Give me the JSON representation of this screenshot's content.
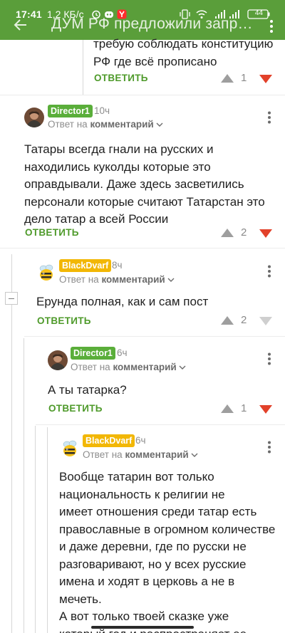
{
  "status_bar": {
    "time": "17:41",
    "network": "1,2 КБ/с",
    "icons": [
      "alarm-icon",
      "discord-icon",
      "yandex-icon"
    ],
    "signal": "4G+",
    "battery": "44"
  },
  "app_bar": {
    "title": "ДУМ РФ предложили запр…"
  },
  "comments": [
    {
      "text_lines": [
        "требую соблюдать конституцию",
        "РФ где всё прописано"
      ],
      "reply_label": "ОТВЕТИТЬ",
      "votes": "1"
    },
    {
      "author": "Director1",
      "time": "10ч",
      "reply_to_prefix": "Ответ на",
      "reply_to_target": "комментарий",
      "text_lines": [
        "Татары всегда гнали на русских и",
        "находились куколды которые это",
        "оправдывали. Даже здесь засветились",
        "персонали которые считают Татарстан это",
        "дело татар а всей России"
      ],
      "reply_label": "ОТВЕТИТЬ",
      "votes": "2"
    },
    {
      "author": "BlackDvarf",
      "time": "8ч",
      "reply_to_prefix": "Ответ на",
      "reply_to_target": "комментарий",
      "text_lines": [
        "Ерунда полная, как и сам пост"
      ],
      "reply_label": "ОТВЕТИТЬ",
      "votes": "2"
    },
    {
      "author": "Director1",
      "time": "6ч",
      "reply_to_prefix": "Ответ на",
      "reply_to_target": "комментарий",
      "text_lines": [
        "А ты татарка?"
      ],
      "reply_label": "ОТВЕТИТЬ",
      "votes": "1"
    },
    {
      "author": "BlackDvarf",
      "time": "6ч",
      "reply_to_prefix": "Ответ на",
      "reply_to_target": "комментарий",
      "text_lines": [
        "Вообще татарин вот только",
        "национальность к религии не",
        "имеет отношения среди татар есть",
        "православные в огромном количестве",
        "и даже деревни, где по русски не",
        "разговаривают, но у всех русские",
        "имена и ходят в церковь а не в мечеть.",
        "А вот только твоей сказке уже",
        "который год и распространяет ее"
      ]
    }
  ],
  "colors": {
    "brand_green": "#5a9e3a",
    "reply_green": "#4e9a2a",
    "downvote_red": "#e2412a",
    "badge_yellow": "#f2b705"
  }
}
